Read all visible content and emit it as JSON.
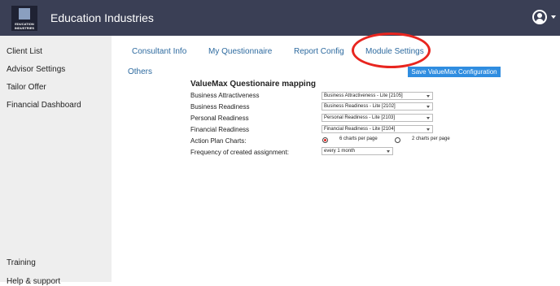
{
  "brand": {
    "logo_text": "EDUCATION INDUSTRIES",
    "title": "Education Industries"
  },
  "sidebar": {
    "items": [
      {
        "label": "Client List"
      },
      {
        "label": "Advisor Settings"
      },
      {
        "label": "Tailor Offer"
      },
      {
        "label": "Financial Dashboard"
      },
      {
        "label": "Training"
      },
      {
        "label": "Help & support"
      }
    ]
  },
  "tabs": [
    {
      "label": "Consultant Info"
    },
    {
      "label": "My Questionnaire"
    },
    {
      "label": "Report Config"
    },
    {
      "label": "Module Settings"
    }
  ],
  "subtabs": {
    "others": "Others"
  },
  "actions": {
    "save_label": "Save ValueMax Configuration"
  },
  "section": {
    "title": "ValueMax Questionaire mapping",
    "rows": [
      {
        "label": "Business Attractiveness",
        "value": "Business Attractiveness - Lite [2105]"
      },
      {
        "label": "Business Readiness",
        "value": "Business Readiness - Lite [2102]"
      },
      {
        "label": "Personal Readiness",
        "value": "Personal Readiness - Lite [2103]"
      },
      {
        "label": "Financial Readiness",
        "value": "Financial Readiness - Lite [2104]"
      }
    ],
    "action_plan": {
      "label": "Action Plan Charts:",
      "option_a": "6 charts per page",
      "option_b": "2 charts per page",
      "selected": "6 charts per page"
    },
    "frequency": {
      "label": "Frequency of created assignment:",
      "value": "every 1 month"
    }
  },
  "colors": {
    "topbar": "#3a3f55",
    "link": "#2d6a9f",
    "button": "#2f8de0",
    "highlight": "#e8251f"
  }
}
